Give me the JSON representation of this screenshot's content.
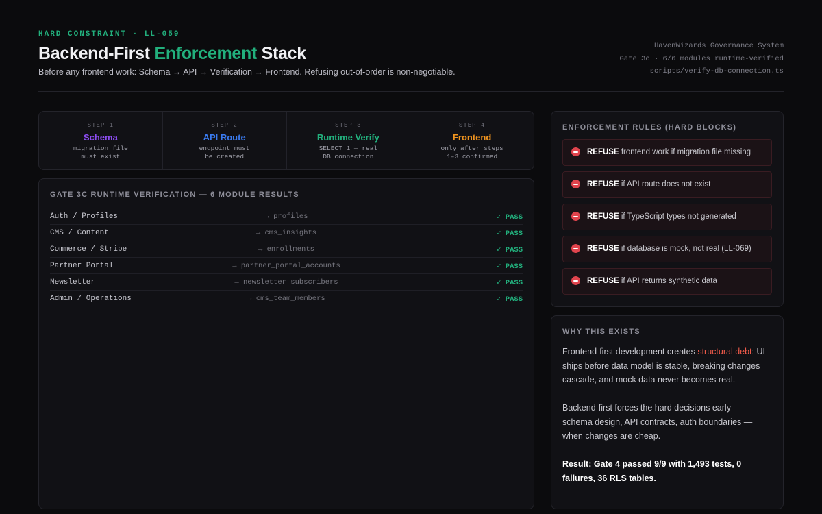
{
  "header": {
    "eyebrow": "HARD CONSTRAINT · LL-059",
    "title_part1": "Backend-First ",
    "title_accent": "Enforcement",
    "title_part2": " Stack",
    "subtitle": "Before any frontend work: Schema → API → Verification → Frontend. Refusing out-of-order is non-negotiable.",
    "meta": [
      "HavenWizards Governance System",
      "Gate 3c · 6/6 modules runtime-verified",
      "scripts/verify-db-connection.ts"
    ]
  },
  "steps": [
    {
      "num": "STEP 1",
      "name": "Schema",
      "desc": "migration file\nmust exist",
      "color": "#8b4cf0"
    },
    {
      "num": "STEP 2",
      "name": "API Route",
      "desc": "endpoint must\nbe created",
      "color": "#3a7bf0"
    },
    {
      "num": "STEP 3",
      "name": "Runtime Verify",
      "desc": "SELECT 1 — real\nDB connection",
      "color": "#22b07d"
    },
    {
      "num": "STEP 4",
      "name": "Frontend",
      "desc": "only after steps\n1–3 confirmed",
      "color": "#f0941f"
    }
  ],
  "gate": {
    "heading": "GATE 3C RUNTIME VERIFICATION — 6 MODULE RESULTS",
    "modules": [
      {
        "name": "Auth / Profiles",
        "table": "→ profiles",
        "status": "✓ PASS"
      },
      {
        "name": "CMS / Content",
        "table": "→ cms_insights",
        "status": "✓ PASS"
      },
      {
        "name": "Commerce / Stripe",
        "table": "→ enrollments",
        "status": "✓ PASS"
      },
      {
        "name": "Partner Portal",
        "table": "→ partner_portal_accounts",
        "status": "✓ PASS"
      },
      {
        "name": "Newsletter",
        "table": "→ newsletter_subscribers",
        "status": "✓ PASS"
      },
      {
        "name": "Admin / Operations",
        "table": "→ cms_team_members",
        "status": "✓ PASS"
      }
    ]
  },
  "rules": {
    "heading": "ENFORCEMENT RULES (HARD BLOCKS)",
    "items": [
      {
        "keyword": "REFUSE",
        "text": " frontend work if migration file missing"
      },
      {
        "keyword": "REFUSE",
        "text": " if API route does not exist"
      },
      {
        "keyword": "REFUSE",
        "text": " if TypeScript types not generated"
      },
      {
        "keyword": "REFUSE",
        "text": " if database is mock, not real (LL-069)"
      },
      {
        "keyword": "REFUSE",
        "text": " if API returns synthetic data"
      }
    ]
  },
  "why": {
    "heading": "WHY THIS EXISTS",
    "p1_before": "Frontend-first development creates ",
    "p1_highlight": "structural debt",
    "p1_after": ": UI ships before data model is stable, breaking changes cascade, and mock data never becomes real.",
    "p2": "Backend-first forces the hard decisions early — schema design, API contracts, auth boundaries — when changes are cheap.",
    "result": "Result: Gate 4 passed 9/9 with 1,493 tests, 0 failures, 36 RLS tables."
  },
  "colors": {
    "accent_green": "#22b07d",
    "refuse_red": "#e0444d",
    "highlight_red": "#ef5a4a"
  }
}
